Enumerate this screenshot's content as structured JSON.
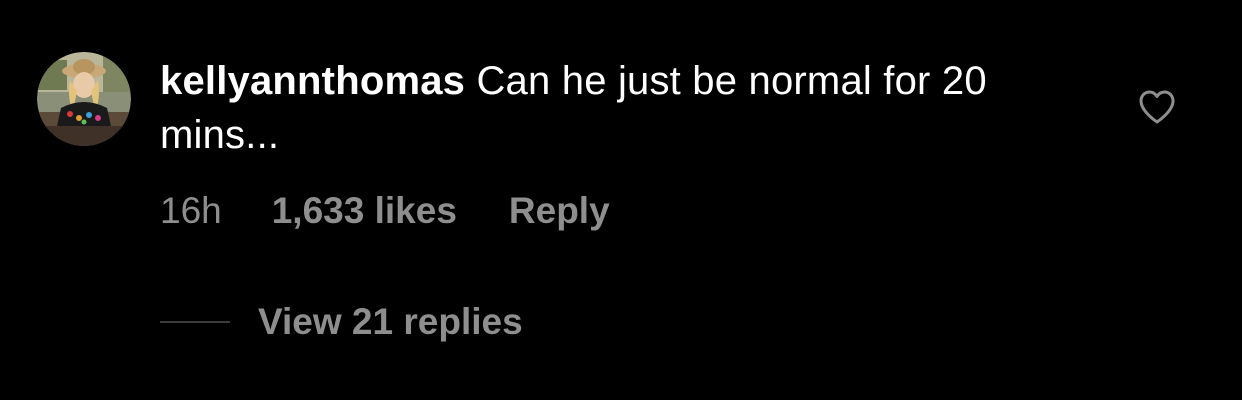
{
  "comment": {
    "username": "kellyannthomas",
    "text": "Can he just be normal for 20 mins...",
    "timestamp": "16h",
    "likes_label": "1,633 likes",
    "reply_label": "Reply",
    "view_replies_label": "View 21 replies",
    "like_icon": "heart-outline-icon",
    "avatar_icon": "user-avatar"
  },
  "colors": {
    "background": "#000000",
    "primary_text": "#ffffff",
    "secondary_text": "#8e8e8e",
    "divider": "#3a3a3a"
  }
}
